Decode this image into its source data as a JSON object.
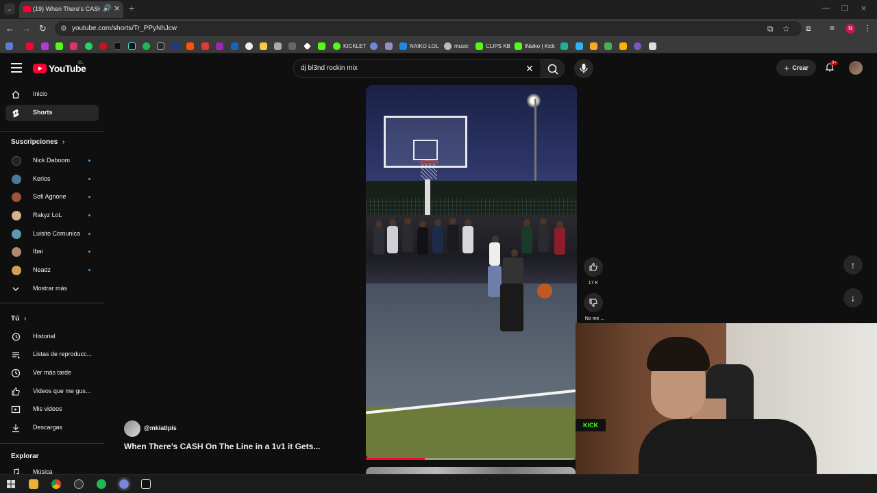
{
  "browser": {
    "tab_title": "(19) When There's CASH On",
    "url": "youtube.com/shorts/Tr_PPyNhJcw",
    "profile_initial": "N",
    "bookmarks": [
      {
        "label": "KICKLET",
        "color": "#53fc18"
      },
      {
        "label": "NAIKO LOL",
        "color": "#1e88e5"
      },
      {
        "label": "music",
        "color": "#bbbbbb"
      },
      {
        "label": "CLIPS KB",
        "color": "#53fc18"
      },
      {
        "label": "lNaiko | Kick",
        "color": "#53fc18"
      }
    ]
  },
  "header": {
    "logo_text": "YouTube",
    "region": "CL",
    "search_value": "dj bl3nd rockin mix",
    "create_label": "Crear",
    "notifications_badge": "9+"
  },
  "sidebar": {
    "main": [
      {
        "label": "Inicio",
        "icon": "home-icon"
      },
      {
        "label": "Shorts",
        "icon": "shorts-icon"
      }
    ],
    "subscriptions_title": "Suscripciones",
    "subscriptions": [
      {
        "label": "Nick Daboom",
        "color": "#222222"
      },
      {
        "label": "Kerios",
        "color": "#4a7a9a"
      },
      {
        "label": "Sofi Agnone",
        "color": "#a0523a"
      },
      {
        "label": "Rakyz LoL",
        "color": "#d8b08a"
      },
      {
        "label": "Luisito Comunica",
        "color": "#5a9ab0"
      },
      {
        "label": "Ibai",
        "color": "#b08870"
      },
      {
        "label": "Neadz",
        "color": "#d0a050"
      }
    ],
    "show_more": "Mostrar más",
    "you_title": "Tú",
    "you_items": [
      {
        "label": "Historial",
        "icon": "history-icon"
      },
      {
        "label": "Listas de reproducc...",
        "icon": "playlists-icon"
      },
      {
        "label": "Ver más tarde",
        "icon": "clock-icon"
      },
      {
        "label": "Videos que me gus...",
        "icon": "thumbs-up-icon"
      },
      {
        "label": "Mis videos",
        "icon": "my-videos-icon"
      },
      {
        "label": "Descargas",
        "icon": "download-icon"
      }
    ],
    "explore_title": "Explorar",
    "explore_items": [
      {
        "label": "Música",
        "icon": "music-icon"
      }
    ]
  },
  "short": {
    "channel": "@mkiatipis",
    "title": "When There’s CASH On The Line in a 1v1 it Gets...",
    "likes": "17 K",
    "dislike_label": "No me ...",
    "progress": 0.28
  },
  "webcam": {
    "kick_badge": "KICK"
  }
}
